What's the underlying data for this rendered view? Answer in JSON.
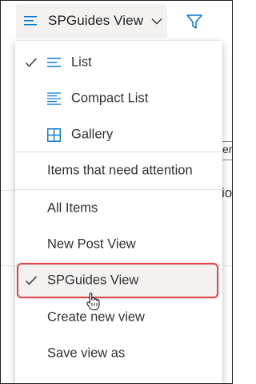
{
  "header": {
    "view_title": "SPGuides View",
    "view_icon": "list-lines-icon",
    "chevron_icon": "chevron-down-icon",
    "filter_icon": "filter-funnel-icon"
  },
  "background": {
    "frag_top": "er",
    "frag_mid": "io"
  },
  "menu": {
    "items": [
      {
        "label": "List",
        "icon": "list-icon",
        "checked": true
      },
      {
        "label": "Compact List",
        "icon": "compact-list-icon",
        "checked": false
      },
      {
        "label": "Gallery",
        "icon": "gallery-grid-icon",
        "checked": false
      },
      {
        "label": "Items that need attention",
        "checked": false
      },
      {
        "label": "All Items",
        "checked": false
      },
      {
        "label": "New Post View",
        "checked": false
      },
      {
        "label": "SPGuides View",
        "checked": true,
        "highlighted": true
      },
      {
        "label": "Create new view",
        "checked": false
      },
      {
        "label": "Save view as",
        "checked": false
      }
    ]
  },
  "colors": {
    "accent": "#0078d4",
    "highlight_border": "#e0474c",
    "text": "#323130",
    "hover_bg": "#f3f2f1"
  }
}
